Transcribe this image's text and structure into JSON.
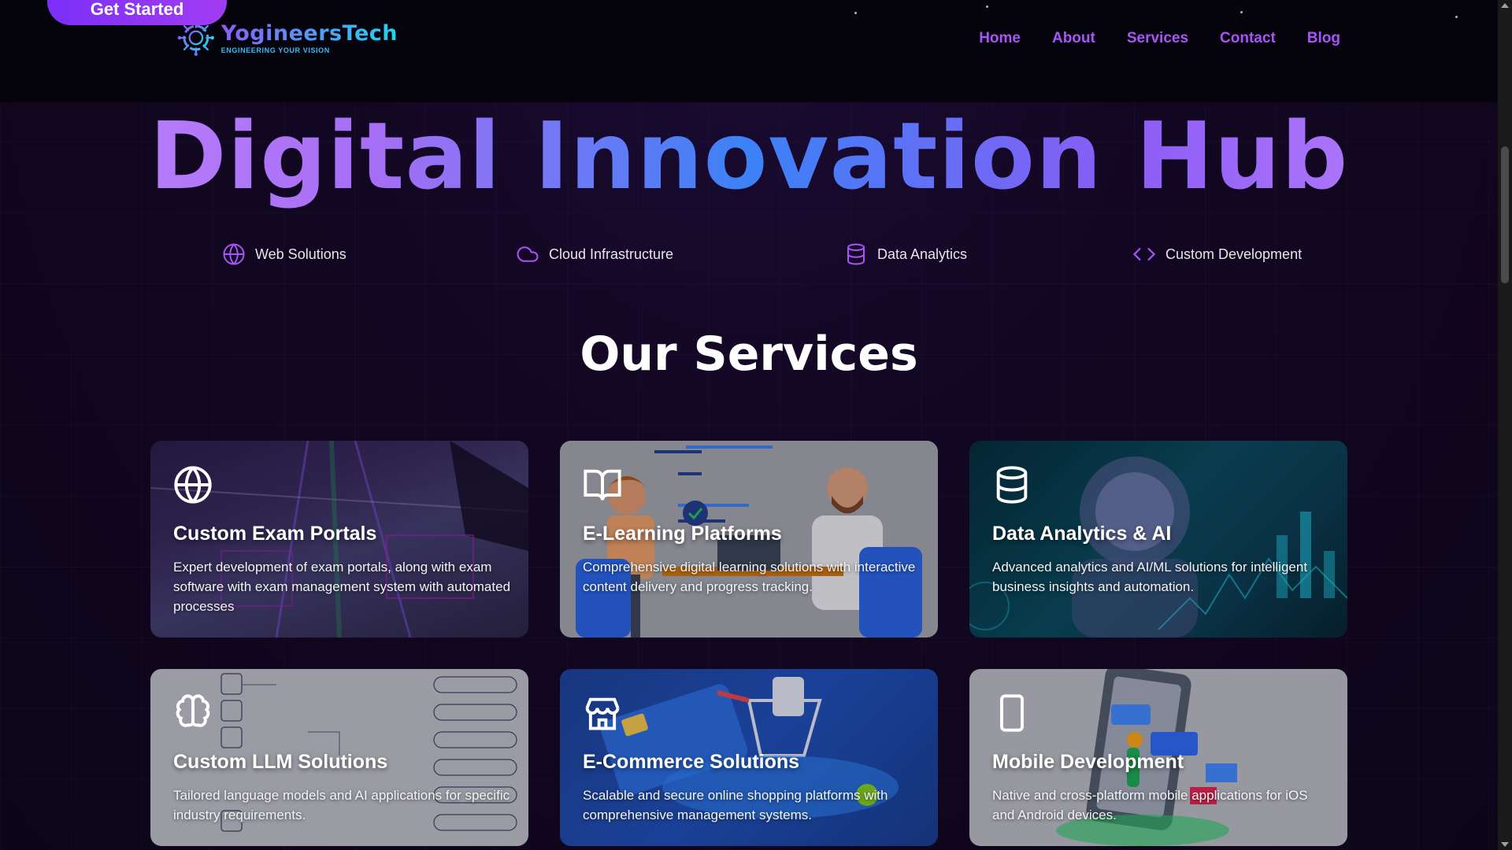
{
  "header": {
    "cta_label": "Get Started",
    "logo": {
      "name": "YogineersTech",
      "tagline": "ENGINEERING YOUR VISION"
    },
    "nav": [
      {
        "label": "Home"
      },
      {
        "label": "About"
      },
      {
        "label": "Services"
      },
      {
        "label": "Contact"
      },
      {
        "label": "Blog"
      }
    ]
  },
  "hero": {
    "title": "Digital Innovation Hub",
    "features": [
      {
        "label": "Web Solutions",
        "icon": "globe-icon"
      },
      {
        "label": "Cloud Infrastructure",
        "icon": "cloud-icon"
      },
      {
        "label": "Data Analytics",
        "icon": "database-icon"
      },
      {
        "label": "Custom Development",
        "icon": "code-icon"
      }
    ]
  },
  "services": {
    "title": "Our Services",
    "cards": [
      {
        "title": "Custom Exam Portals",
        "description": "Expert development of exam portals, along with exam software with exam management system with automated processes",
        "icon": "globe-icon"
      },
      {
        "title": "E-Learning Platforms",
        "description": "Comprehensive digital learning solutions with interactive content delivery and progress tracking.",
        "icon": "book-open-icon"
      },
      {
        "title": "Data Analytics & AI",
        "description": "Advanced analytics and AI/ML solutions for intelligent business insights and automation.",
        "icon": "database-icon"
      },
      {
        "title": "Custom LLM Solutions",
        "description": "Tailored language models and AI applications for specific industry requirements.",
        "icon": "brain-icon"
      },
      {
        "title": "E-Commerce Solutions",
        "description": "Scalable and secure online shopping platforms with comprehensive management systems.",
        "icon": "store-icon"
      },
      {
        "title": "Mobile Development",
        "description": "Native and cross-platform mobile applications for iOS and Android devices.",
        "icon": "smartphone-icon"
      }
    ]
  },
  "colors": {
    "accent_purple": "#a855f7",
    "cta_gradient_start": "#7b2ff7",
    "background": "#0d0619"
  }
}
